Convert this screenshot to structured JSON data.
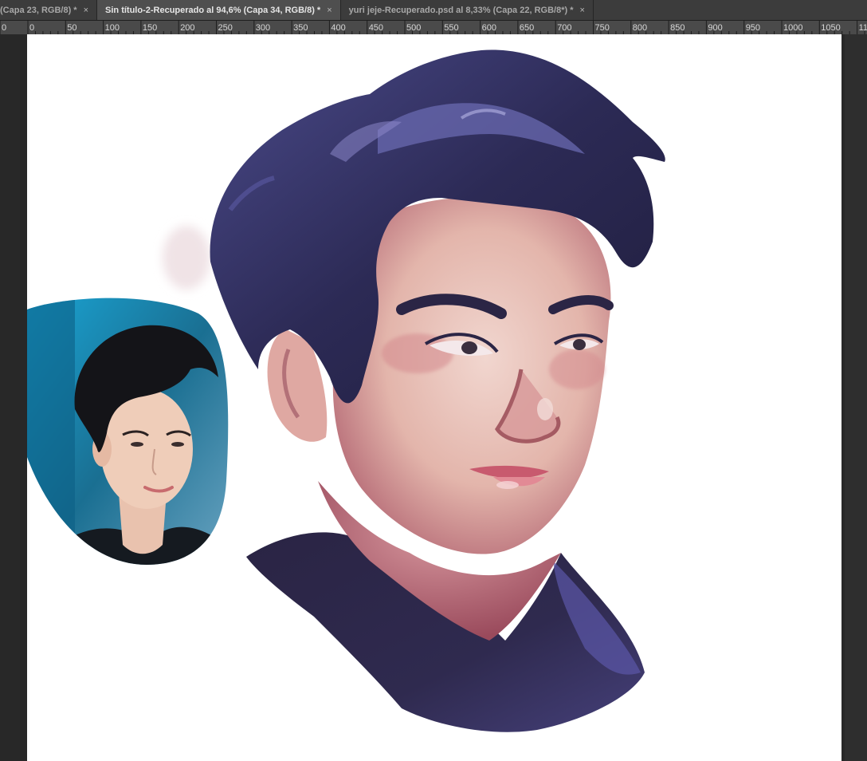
{
  "tabs": [
    {
      "label": "(Capa 23, RGB/8) *",
      "close": "×",
      "active": false
    },
    {
      "label": "Sin título-2-Recuperado al 94,6% (Capa 34, RGB/8) *",
      "close": "×",
      "active": true
    },
    {
      "label": "yuri jeje-Recuperado.psd al 8,33% (Capa 22, RGB/8*) *",
      "close": "×",
      "active": false
    }
  ],
  "ruler": {
    "labels": [
      "0",
      "0",
      "50",
      "100",
      "150",
      "200",
      "250",
      "300",
      "350",
      "400",
      "450",
      "500",
      "550",
      "600",
      "650",
      "700",
      "750",
      "800",
      "850",
      "900",
      "950",
      "1000",
      "1050",
      "11"
    ]
  },
  "colors": {
    "ui_dark": "#282828",
    "tab_bar": "#3c3c3c",
    "tab_active": "#4f4f4f",
    "ruler_bg": "#4a4a4a",
    "canvas": "#ffffff",
    "hair": "#2c2a4e",
    "skin": "#e8c2b8",
    "shirt": "#2b2745",
    "photo_bg": "#1f8fb8"
  }
}
